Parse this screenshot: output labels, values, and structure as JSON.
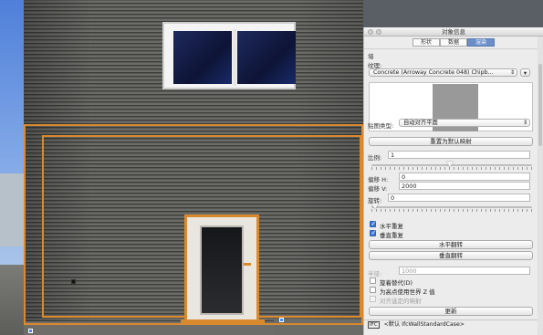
{
  "panel": {
    "title": "对象信息",
    "tabs": [
      {
        "label": "形状"
      },
      {
        "label": "数据"
      },
      {
        "label": "渲染"
      }
    ],
    "active_tab": "渲染",
    "section": "墙",
    "texture_label": "纹理:",
    "texture_value": "Concrete (Arroway Concrete 048) Chipb...",
    "mapping_label": "贴图类型:",
    "mapping_value": "自动对齐平面",
    "reset_button": "重置为默认映射",
    "scale_label": "比例:",
    "scale_value": "1",
    "offset_h_label": "偏移 H:",
    "offset_h_value": "0",
    "offset_v_label": "偏移 V:",
    "offset_v_value": "2000",
    "rotation_label": "旋转:",
    "rotation_value": "0",
    "repeat_h_label": "水平重复",
    "repeat_v_label": "垂直重复",
    "flip_h_button": "水平翻转",
    "flip_v_button": "垂直翻转",
    "radius_label": "半径:",
    "radius_value": "1000",
    "cb_default": "旋着替代(D)",
    "cb_world_z": "为高点使用世界 Z 值",
    "cb_selected": "对齐选定的映射",
    "update_button": "更新",
    "status_badge": "IFC",
    "status_text": "<默认 IfcWallStandardCase>"
  },
  "checkbox_state": {
    "repeat_h": true,
    "repeat_v": true,
    "cb_default": false,
    "cb_world_z": false,
    "cb_selected": false
  },
  "colors": {
    "selection": "#d9892e",
    "active_tab": "#6d8fc9",
    "checkbox_on": "#3a78d8"
  },
  "icons": {
    "texture_menu": "chevron-down-icon",
    "window_controls": "traffic-light-icon"
  }
}
